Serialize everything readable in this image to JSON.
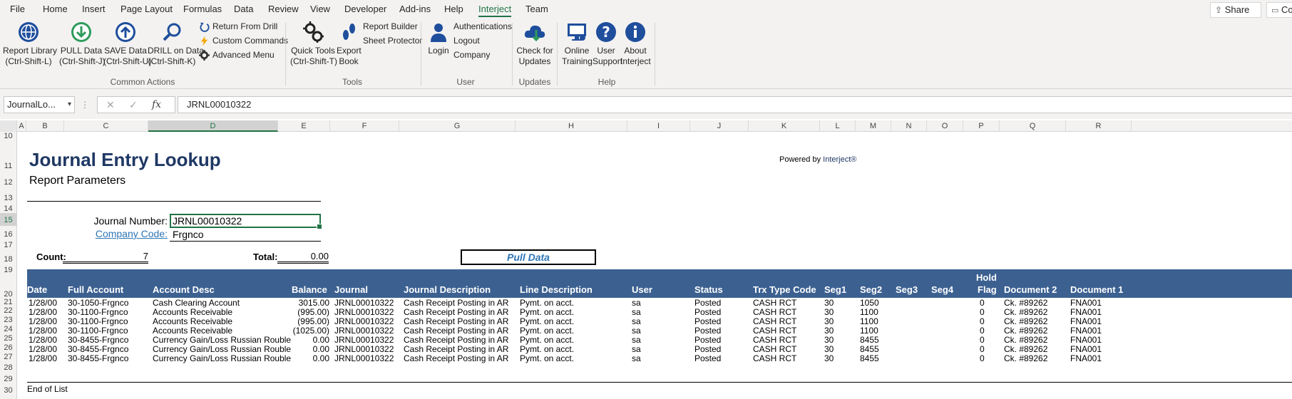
{
  "menu": {
    "tabs": [
      "File",
      "Home",
      "Insert",
      "Page Layout",
      "Formulas",
      "Data",
      "Review",
      "View",
      "Developer",
      "Add-ins",
      "Help",
      "Interject",
      "Team"
    ],
    "active_tab": "Interject",
    "share_label": "Share",
    "comments_label": "Co"
  },
  "ribbon": {
    "common_actions": {
      "report_library": [
        "Report Library",
        "(Ctrl-Shift-L)"
      ],
      "pull_data": [
        "PULL Data",
        "(Ctrl-Shift-J)"
      ],
      "save_data": [
        "SAVE Data",
        "(Ctrl-Shift-U)"
      ],
      "drill_on_data": [
        "DRILL on Data",
        "(Ctrl-Shift-K)"
      ],
      "return_from_drill": "Return From Drill",
      "custom_commands": "Custom Commands",
      "advanced_menu": "Advanced Menu",
      "label": "Common Actions"
    },
    "tools": {
      "quick_tools": [
        "Quick Tools",
        "(Ctrl-Shift-T)"
      ],
      "export_book": [
        "Export",
        "Book"
      ],
      "report_builder": "Report Builder",
      "sheet_protector": "Sheet Protector",
      "label": "Tools"
    },
    "user": {
      "login": "Login",
      "authentications": "Authentications",
      "logout": "Logout",
      "company": "Company",
      "label": "User"
    },
    "updates": {
      "check_for_updates": [
        "Check for",
        "Updates"
      ],
      "label": "Updates"
    },
    "help": {
      "online_training": [
        "Online",
        "Training"
      ],
      "user_support": [
        "User",
        "Support"
      ],
      "about_interject": [
        "About",
        "Interject"
      ],
      "label": "Help"
    }
  },
  "formula_bar": {
    "name_box": "JournalLo...",
    "formula": "JRNL00010322"
  },
  "columns": [
    "A",
    "B",
    "C",
    "D",
    "E",
    "F",
    "G",
    "H",
    "I",
    "J",
    "K",
    "L",
    "M",
    "N",
    "O",
    "P",
    "Q",
    "R"
  ],
  "selected_column": "D",
  "rows": [
    "10",
    "11",
    "12",
    "13",
    "14",
    "15",
    "16",
    "17",
    "18",
    "19",
    "20",
    "21",
    "22",
    "23",
    "24",
    "25",
    "26",
    "27",
    "28",
    "29",
    "30"
  ],
  "selected_row": "15",
  "report": {
    "title": "Journal Entry Lookup",
    "subtitle": "Report Parameters",
    "powered_by_prefix": "Powered by ",
    "powered_by_brand": "Interject®",
    "journal_number_label": "Journal Number:",
    "journal_number_value": "JRNL00010322",
    "company_code_label": "Company Code:",
    "company_code_value": "Frgnco",
    "count_label": "Count:",
    "count_value": "7",
    "total_label": "Total:",
    "total_value": "0.00",
    "pull_data_button": "Pull Data",
    "end_of_list": "End of List"
  },
  "table": {
    "hold_label": "Hold",
    "headers": [
      "Date",
      "Full Account",
      "Account Desc",
      "Balance",
      "Journal",
      "Journal Description",
      "Line Description",
      "User",
      "Status",
      "Trx Type Code",
      "Seg1",
      "Seg2",
      "Seg3",
      "Seg4",
      "Flag",
      "Document 2",
      "Document 1"
    ],
    "rows": [
      [
        "1/28/00",
        "30-1050-Frgnco",
        "Cash Clearing Account",
        "3015.00",
        "JRNL00010322",
        "Cash Receipt Posting in AR",
        "Pymt. on acct.",
        "sa",
        "Posted",
        "CASH RCT",
        "30",
        "1050",
        "",
        "",
        "0",
        "Ck. #89262",
        "FNA001"
      ],
      [
        "1/28/00",
        "30-1100-Frgnco",
        "Accounts Receivable",
        "(995.00)",
        "JRNL00010322",
        "Cash Receipt Posting in AR",
        "Pymt. on acct.",
        "sa",
        "Posted",
        "CASH RCT",
        "30",
        "1100",
        "",
        "",
        "0",
        "Ck. #89262",
        "FNA001"
      ],
      [
        "1/28/00",
        "30-1100-Frgnco",
        "Accounts Receivable",
        "(995.00)",
        "JRNL00010322",
        "Cash Receipt Posting in AR",
        "Pymt. on acct.",
        "sa",
        "Posted",
        "CASH RCT",
        "30",
        "1100",
        "",
        "",
        "0",
        "Ck. #89262",
        "FNA001"
      ],
      [
        "1/28/00",
        "30-1100-Frgnco",
        "Accounts Receivable",
        "(1025.00)",
        "JRNL00010322",
        "Cash Receipt Posting in AR",
        "Pymt. on acct.",
        "sa",
        "Posted",
        "CASH RCT",
        "30",
        "1100",
        "",
        "",
        "0",
        "Ck. #89262",
        "FNA001"
      ],
      [
        "1/28/00",
        "30-8455-Frgnco",
        "Currency Gain/Loss Russian Rouble",
        "0.00",
        "JRNL00010322",
        "Cash Receipt Posting in AR",
        "Pymt. on acct.",
        "sa",
        "Posted",
        "CASH RCT",
        "30",
        "8455",
        "",
        "",
        "0",
        "Ck. #89262",
        "FNA001"
      ],
      [
        "1/28/00",
        "30-8455-Frgnco",
        "Currency Gain/Loss Russian Rouble",
        "0.00",
        "JRNL00010322",
        "Cash Receipt Posting in AR",
        "Pymt. on acct.",
        "sa",
        "Posted",
        "CASH RCT",
        "30",
        "8455",
        "",
        "",
        "0",
        "Ck. #89262",
        "FNA001"
      ],
      [
        "1/28/00",
        "30-8455-Frgnco",
        "Currency Gain/Loss Russian Rouble",
        "0.00",
        "JRNL00010322",
        "Cash Receipt Posting in AR",
        "Pymt. on acct.",
        "sa",
        "Posted",
        "CASH RCT",
        "30",
        "8455",
        "",
        "",
        "0",
        "Ck. #89262",
        "FNA001"
      ]
    ]
  },
  "colors": {
    "excel_green": "#217346",
    "interject_blue": "#1f3864",
    "header_fill": "#3c6191",
    "link_blue": "#2e75b6",
    "ribbon_icon_blue": "#1f4e9c"
  }
}
